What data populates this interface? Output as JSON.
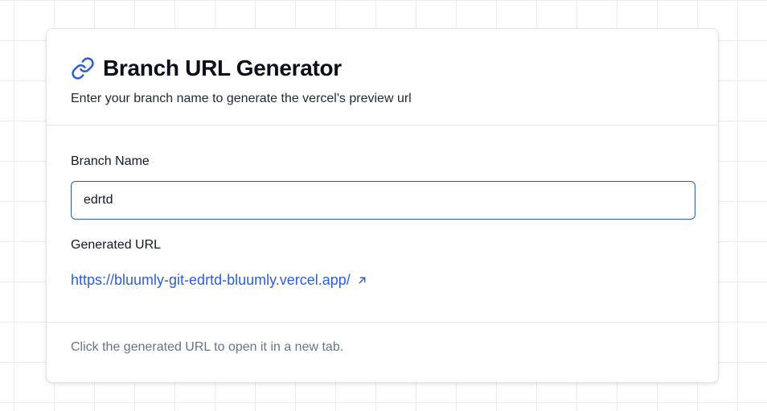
{
  "header": {
    "title": "Branch URL Generator",
    "subtitle": "Enter your branch name to generate the vercel's preview url",
    "icon": "link-icon"
  },
  "form": {
    "branch_label": "Branch Name",
    "branch_value": "edrtd",
    "generated_label": "Generated URL",
    "generated_url": "https://bluumly-git-edrtd-bluumly.vercel.app/",
    "external_icon": "external-link-icon"
  },
  "footer": {
    "hint": "Click the generated URL to open it in a new tab."
  },
  "colors": {
    "accent": "#2d5fd3",
    "input_border": "#2b5aa8",
    "muted_text": "#64748b"
  }
}
